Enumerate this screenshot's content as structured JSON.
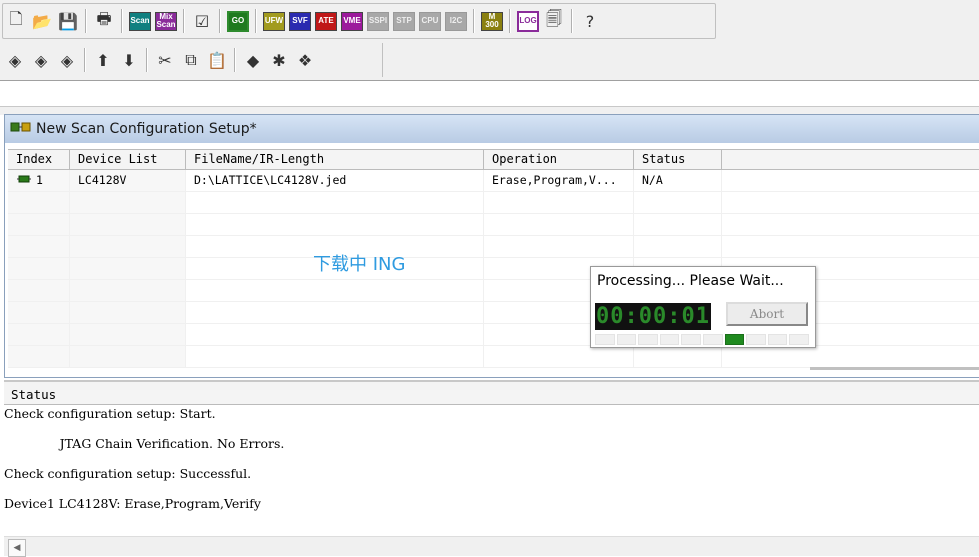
{
  "toolbar": {
    "row1": [
      {
        "name": "new-file-icon",
        "type": "icon",
        "glyph": "🗋"
      },
      {
        "name": "open-folder-icon",
        "type": "icon",
        "glyph": "📂"
      },
      {
        "name": "save-icon",
        "type": "icon",
        "glyph": "💾"
      },
      {
        "type": "sep"
      },
      {
        "name": "print-icon",
        "type": "icon",
        "glyph": "🖶"
      },
      {
        "type": "sep"
      },
      {
        "name": "scan-icon",
        "type": "label",
        "text": "Scan",
        "color": "teal"
      },
      {
        "name": "mix-scan-icon",
        "type": "label",
        "text": "Mix Scan",
        "color": "purple"
      },
      {
        "type": "sep"
      },
      {
        "name": "checklist-icon",
        "type": "icon",
        "glyph": "☑"
      },
      {
        "type": "sep"
      },
      {
        "name": "go-icon",
        "type": "label",
        "text": "GO",
        "color": "green"
      },
      {
        "type": "sep"
      },
      {
        "name": "ufw-icon",
        "type": "label",
        "text": "UFW",
        "color": "olive"
      },
      {
        "name": "svf-icon",
        "type": "label",
        "text": "SVF",
        "color": "blue"
      },
      {
        "name": "ate-icon",
        "type": "label",
        "text": "ATE",
        "color": "red"
      },
      {
        "name": "vme-icon",
        "type": "label",
        "text": "VME",
        "color": "magenta"
      },
      {
        "name": "sspi-icon",
        "type": "label",
        "text": "SSPI",
        "color": "gray"
      },
      {
        "name": "stp-icon",
        "type": "label",
        "text": "STP",
        "color": "gray"
      },
      {
        "name": "cpu-icon",
        "type": "label",
        "text": "CPU",
        "color": "gray"
      },
      {
        "name": "i2c-icon",
        "type": "label",
        "text": "I2C",
        "color": "gray"
      },
      {
        "type": "sep"
      },
      {
        "name": "m300-icon",
        "type": "label",
        "text": "M 300",
        "color": "dkolive"
      },
      {
        "type": "sep"
      },
      {
        "name": "log-icon",
        "type": "label",
        "text": "LOG",
        "color": "logpurple"
      },
      {
        "name": "export-icon",
        "type": "icon",
        "glyph": "🗐"
      },
      {
        "type": "sep"
      },
      {
        "name": "help-icon",
        "type": "icon",
        "glyph": "?"
      }
    ],
    "row2": [
      {
        "name": "chip-add-icon",
        "type": "icon",
        "glyph": "◈"
      },
      {
        "name": "chip-insert-icon",
        "type": "icon",
        "glyph": "◈"
      },
      {
        "name": "chip-remove-icon",
        "type": "icon",
        "glyph": "◈"
      },
      {
        "type": "sep"
      },
      {
        "name": "chip-up-icon",
        "type": "icon",
        "glyph": "⬆"
      },
      {
        "name": "chip-down-icon",
        "type": "icon",
        "glyph": "⬇"
      },
      {
        "type": "sep"
      },
      {
        "name": "cut-icon",
        "type": "icon",
        "glyph": "✂"
      },
      {
        "name": "copy-icon",
        "type": "icon",
        "glyph": "⧉"
      },
      {
        "name": "paste-icon",
        "type": "icon",
        "glyph": "📋"
      },
      {
        "type": "sep"
      },
      {
        "name": "chip-edit-icon",
        "type": "icon",
        "glyph": "◆"
      },
      {
        "name": "chip-settings-icon",
        "type": "icon",
        "glyph": "✱"
      },
      {
        "name": "chip-scan-icon",
        "type": "icon",
        "glyph": "❖"
      }
    ]
  },
  "config_window": {
    "title": "New Scan Configuration Setup*",
    "columns": {
      "index": "Index",
      "device": "Device List",
      "file": "FileName/IR-Length",
      "operation": "Operation",
      "status": "Status"
    },
    "rows": [
      {
        "index": "1",
        "device": "LC4128V",
        "file": "D:\\LATTICE\\LC4128V.jed",
        "operation": "Erase,Program,V...",
        "status": "N/A"
      }
    ],
    "overlay_text": "下载中 ING"
  },
  "status_pane": {
    "header": "Status",
    "lines": [
      "Check configuration setup: Start.",
      "              JTAG Chain Verification. No Errors.",
      "Check configuration setup: Successful.",
      "Device1 LC4128V: Erase,Program,Verify"
    ]
  },
  "processing_dialog": {
    "message": "Processing... Please Wait...",
    "timer": "00:00:01",
    "abort_label": "Abort",
    "progress_segments": 10,
    "progress_active_index": 6
  },
  "colors": {
    "title_bar": "#c8d8ee",
    "overlay_text": "#2f9be0",
    "progress_active": "#1f8a1f",
    "timer_digits": "#2a8a2a"
  }
}
